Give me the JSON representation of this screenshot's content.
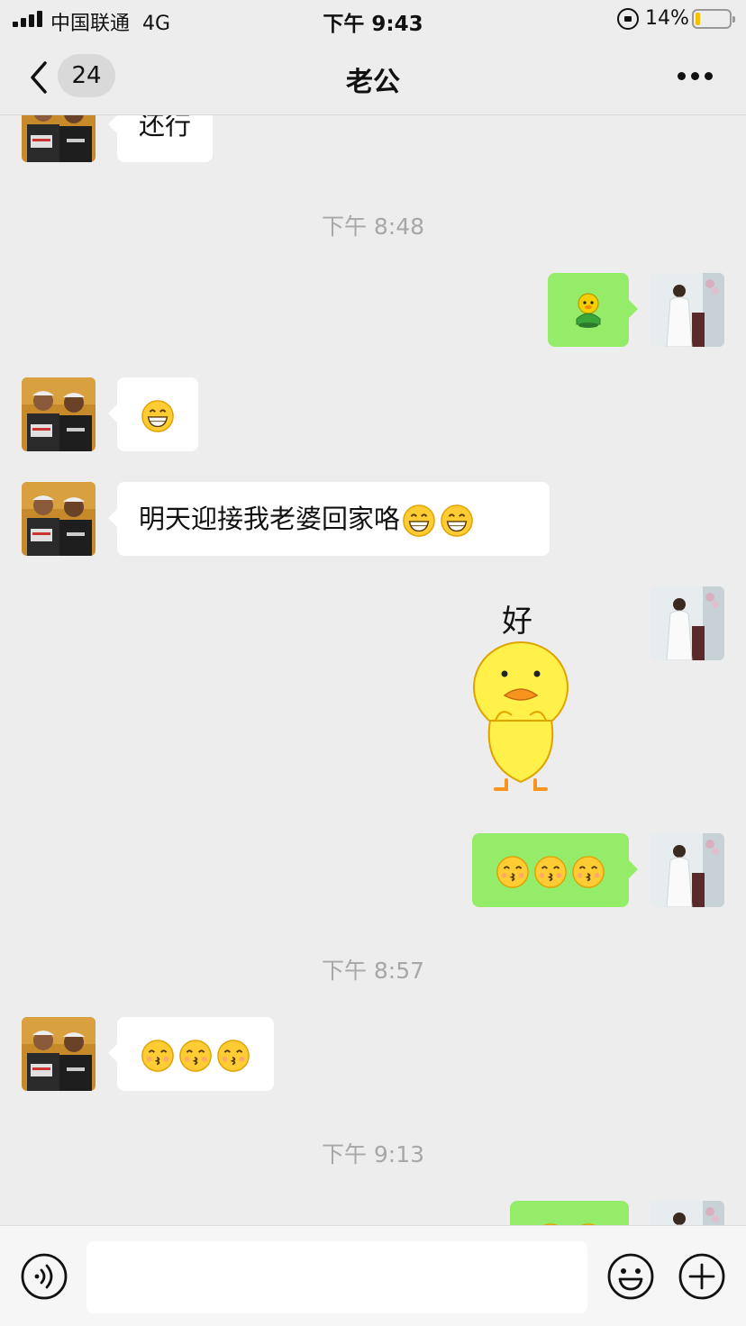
{
  "status_bar": {
    "carrier": "中国联通",
    "network": "4G",
    "time": "下午 9:43",
    "battery": "14%",
    "battery_level": 0.14
  },
  "header": {
    "unread_count": "24",
    "title": "老公"
  },
  "messages": {
    "m0_text": "还行",
    "ts1": "下午 8:48",
    "m1_type": "emoji",
    "m1_icon": "green-duck-emoji-icon",
    "m2_icon": "grin-emoji-icon",
    "m3_text": "明天迎接我老婆回家咯",
    "m3_icons": [
      "grin-emoji-icon",
      "grin-emoji-icon"
    ],
    "m4_sticker_text": "好",
    "m4_sticker_icon": "yellow-duck-sticker-icon",
    "m5_icons": [
      "kiss-emoji-icon",
      "kiss-emoji-icon",
      "kiss-emoji-icon"
    ],
    "ts2": "下午 8:57",
    "m6_icons": [
      "kiss-emoji-icon",
      "kiss-emoji-icon",
      "kiss-emoji-icon"
    ],
    "ts3": "下午 9:13"
  },
  "colors": {
    "background": "#ededed",
    "sent_bubble": "#95ec69",
    "received_bubble": "#ffffff",
    "timestamp": "#a7a7a7"
  },
  "input_bar": {
    "voice_icon": "voice-icon",
    "emoji_icon": "emoji-icon",
    "plus_icon": "plus-icon"
  }
}
